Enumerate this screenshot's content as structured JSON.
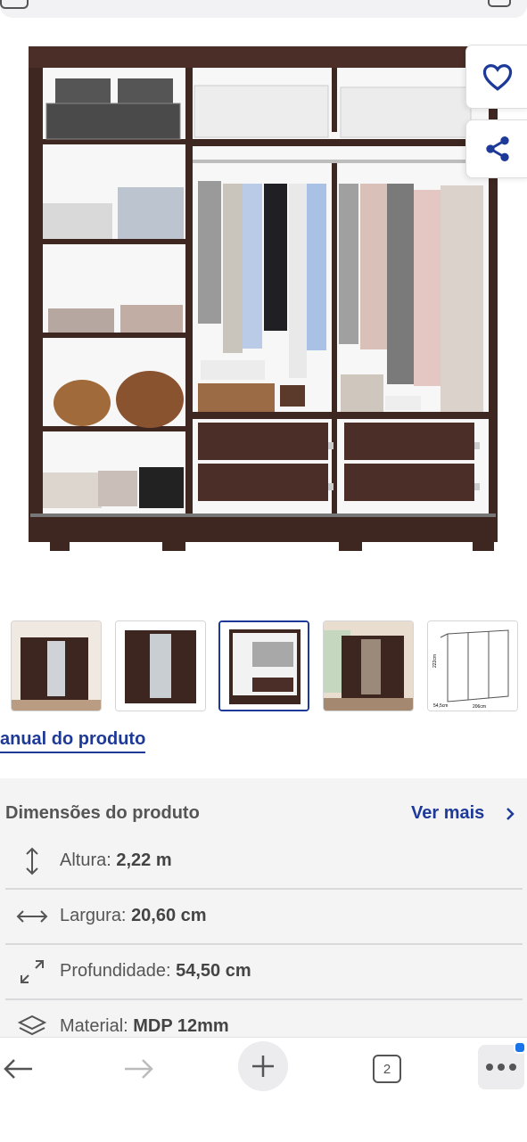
{
  "manual_link": "anual do produto",
  "dimensions": {
    "title": "Dimensões do produto",
    "ver_mais": "Ver mais",
    "rows": [
      {
        "label": "Altura:",
        "value": "2,22 m",
        "icon": "vertical-arrows-icon"
      },
      {
        "label": "Largura:",
        "value": "20,60 cm",
        "icon": "horizontal-arrows-icon"
      },
      {
        "label": "Profundidade:",
        "value": "54,50 cm",
        "icon": "diagonal-arrows-icon"
      },
      {
        "label": "Material:",
        "value": "MDP 12mm",
        "icon": "layers-icon"
      }
    ]
  },
  "thumbnails": {
    "count": 5,
    "active_index": 2,
    "diagram_labels": {
      "height": "222cm",
      "depth": "54,5cm",
      "width": "206cm"
    }
  },
  "navbar": {
    "tab_count": "2"
  },
  "colors": {
    "accent": "#1e3a99",
    "wood": "#3d2620",
    "badge": "#1a73e8"
  }
}
